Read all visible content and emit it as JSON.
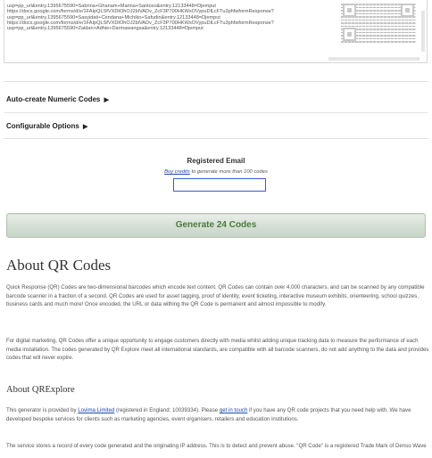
{
  "url_list": {
    "lines": [
      "usp=pp_url&entry.1395675590=Sabrina+Ghanam+Marina+Santoso&entry.12133448=Djemput",
      "https://docs.google.com/forms/d/e/1FAIpQLSfVXDtOhOJ2blVADv_ZcF3P700HKWsOVypuDlLcFTu3phfwformResponse?",
      "usp=pp_url&entry.1395675590=Sasyidati+Cendana+Michiko+Safudin&entry.12133448=Djemput",
      "https://docs.google.com/forms/d/e/1FAIpQLSfVXDtOhOJ2blVADv_ZcF3P700HKWsOVypuDlLcFTu3phfwformResponse?",
      "usp=pp_url&entry.1395675590=Zaidan+Adhie+Darmawangsa&entry.12133448=Djemput"
    ]
  },
  "sections": {
    "auto_create": "Auto-create Numeric Codes",
    "configurable": "Configurable Options",
    "triangle": "▶"
  },
  "registered": {
    "title": "Registered Email",
    "buy_link": "Buy credits",
    "subtitle_rest": " to generate more than 100 codes",
    "input_value": ""
  },
  "generate_button": "Generate 24 Codes",
  "about_qr": {
    "heading": "About QR Codes",
    "p1": "Quick Response (QR) Codes are two-dimensional barcodes which encode text content. QR Codes can contain over 4,000 characters, and can be scanned by any compatible barcode scanner in a fraction of a second. QR Codes are used for asset tagging, proof of identity, event ticketing, interactive museum exhibits, orienteering, school quizzes, business cards and much more! Once encoded, the URL or data withing the QR Code is permanent and almost impossible to modify.",
    "p2": "For digital marketing, QR Codes offer a unique opportunity to engage customers directly with media whilst adding unique tracking data to measure the performance of each media installation. The codes generated by QR Explore meet all international standards, are compatible with all barcode scanners, do not add anything to the data and provides codes that will never expire."
  },
  "about_qrexplore": {
    "heading": "About QRExplore",
    "p1_a": "This generator is provided by ",
    "p1_link1": "Lovima Limited",
    "p1_b": " (registered in England: 10039334). Please ",
    "p1_link2": "get in touch",
    "p1_c": " if you have any QR code projects that you need help with. We have developed bespoke services for clients such as marketing agencies, event organisers, retailers and education institutions.",
    "p2": "The service stores a record of every code generated and the originating IP address. This is to detect and prevent abuse. \"QR Code\" is a registered Trade Mark of Denso Wave"
  }
}
